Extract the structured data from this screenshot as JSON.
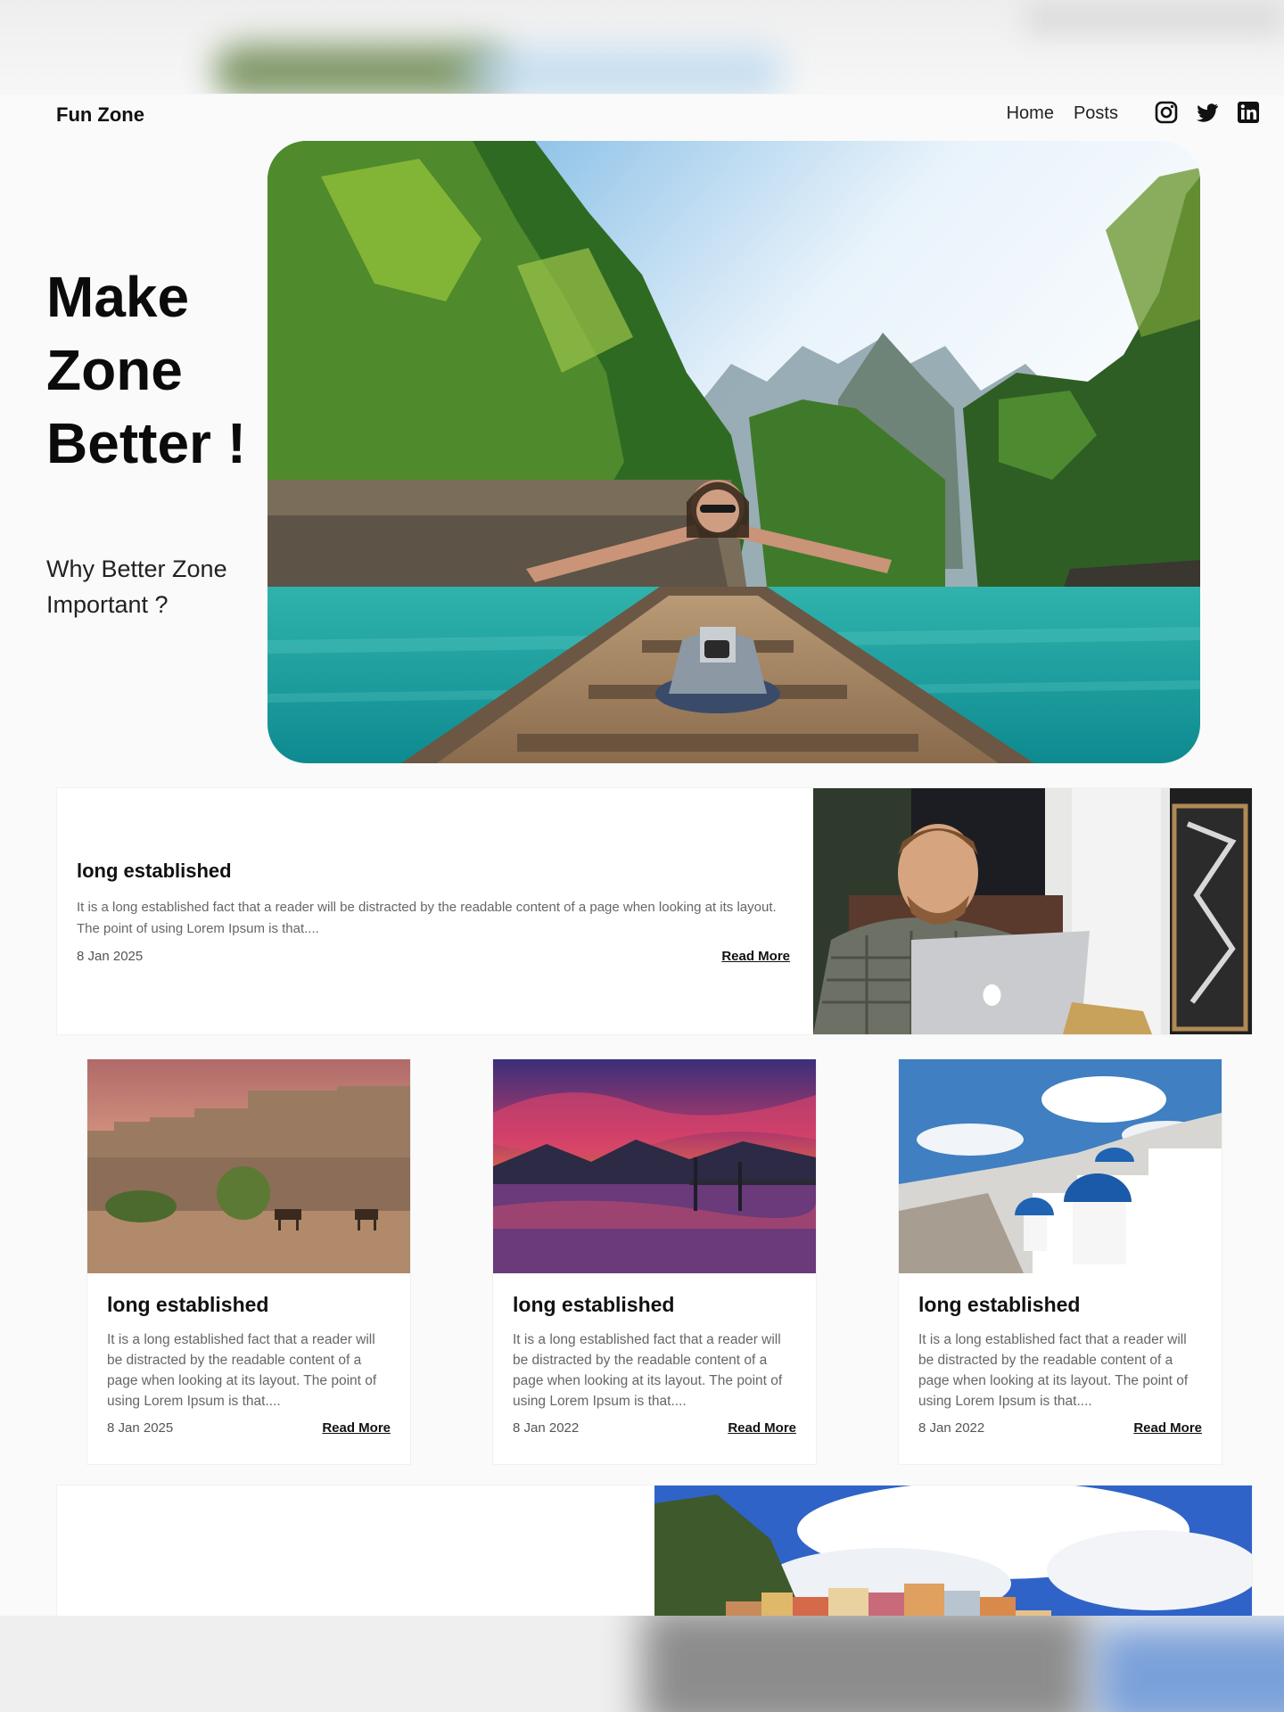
{
  "header": {
    "brand": "Fun Zone",
    "nav": [
      {
        "label": "Home"
      },
      {
        "label": "Posts"
      }
    ],
    "social": [
      "instagram-icon",
      "twitter-icon",
      "linkedin-icon"
    ]
  },
  "hero": {
    "title": "Make Zone Better !",
    "subtitle": "Why Better Zone Important ?",
    "image": "woman-sitting-on-boat-in-lagoon"
  },
  "featured_post": {
    "title": "long established",
    "excerpt": "It is a long established fact that a reader will be distracted by the readable content of a page when looking at its layout. The point of using Lorem Ipsum is that....",
    "date": "8 Jan 2025",
    "read_more": "Read More",
    "image": "man-with-laptop"
  },
  "posts": [
    {
      "title": "long established",
      "excerpt": "It is a long established fact that a reader will be distracted by the readable content of a page when looking at its layout. The point of using Lorem Ipsum is that....",
      "date": "8 Jan 2025",
      "read_more": "Read More",
      "image": "fort-with-camels"
    },
    {
      "title": "long established",
      "excerpt": "It is a long established fact that a reader will be distracted by the readable content of a page when looking at its layout. The point of using Lorem Ipsum is that....",
      "date": "8 Jan 2022",
      "read_more": "Read More",
      "image": "purple-sunset-lake"
    },
    {
      "title": "long established",
      "excerpt": "It is a long established fact that a reader will be distracted by the readable content of a page when looking at its layout. The point of using Lorem Ipsum is that....",
      "date": "8 Jan 2022",
      "read_more": "Read More",
      "image": "white-blue-dome-village"
    }
  ],
  "colors": {
    "text": "#111111",
    "muted": "#666666",
    "background": "#fafafa",
    "lagoon": "#1fa8a0"
  }
}
